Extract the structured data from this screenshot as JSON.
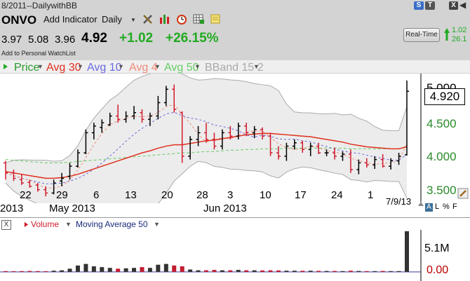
{
  "window": {
    "title": "8/2011--DailywithBB"
  },
  "toolbar": {
    "symbol": "ONVO",
    "add_indicator": "Add Indicator",
    "period": "Daily",
    "period_caret": "▼",
    "tools": [
      "wrench-icon",
      "bars-icon",
      "alarm-clock-icon",
      "grid-icon",
      "note-icon"
    ]
  },
  "top_right": {
    "s_badge": "S",
    "t_badge": "T",
    "close": "X",
    "arrow": "◀"
  },
  "quote": {
    "open": "3.97",
    "high": "5.08",
    "low": "3.96",
    "last": "4.92",
    "change": "+1.02",
    "change_pct": "+26.15%",
    "watchlist_link": "Add to Personal WatchList",
    "realtime_label": "Real-Time",
    "side_value_1": "1.02",
    "side_value_2": "26.1"
  },
  "colors": {
    "price": "#000000",
    "avg30": "#e0301e",
    "avg10": "#6a6ae0",
    "avg4": "#f08a7a",
    "avg50": "#66cc66",
    "bband": "#aaaaaa",
    "up_bar": "#000000",
    "down_bar": "#d01c2c",
    "positive": "#22aa22"
  },
  "legend": {
    "price": "Price",
    "avg30": "Avg 30",
    "avg10": "Avg 10",
    "avg4": "Avg 4",
    "avg50": "Avg 50",
    "bband": "BBand 15 2"
  },
  "x_axis": {
    "day_ticks": [
      "22",
      "29",
      "6",
      "13",
      "20",
      "28",
      "3",
      "10",
      "17",
      "24",
      "1"
    ],
    "month_labels": [
      "2013",
      "May 2013",
      "Jun 2013"
    ],
    "date_readout": "7/9/13"
  },
  "y_axis": {
    "ticks": [
      "5.000",
      "4.500",
      "4.000",
      "3.500"
    ],
    "current_price": "4.920"
  },
  "scale_controls": {
    "a": "A",
    "l": "L",
    "pct": "%",
    "f": "F"
  },
  "volume": {
    "close_x": "X",
    "label": "Volume",
    "ma_label": "Moving Average 50",
    "current": "5.1M",
    "zero": "0.00"
  },
  "chart_data": {
    "type": "ohlc",
    "title": "ONVO",
    "ylim": [
      3.3,
      5.1
    ],
    "series_names": [
      "Price",
      "Avg 30",
      "Avg 10",
      "Avg 4",
      "Avg 50",
      "BBand 15 2"
    ],
    "ohlc": [
      [
        3.85,
        3.88,
        3.6,
        3.7
      ],
      [
        3.7,
        3.75,
        3.58,
        3.62
      ],
      [
        3.6,
        3.68,
        3.52,
        3.55
      ],
      [
        3.56,
        3.6,
        3.48,
        3.5
      ],
      [
        3.52,
        3.55,
        3.42,
        3.45
      ],
      [
        3.45,
        3.5,
        3.35,
        3.4
      ],
      [
        3.4,
        3.6,
        3.38,
        3.55
      ],
      [
        3.58,
        3.7,
        3.5,
        3.62
      ],
      [
        3.65,
        3.85,
        3.6,
        3.8
      ],
      [
        3.8,
        4.05,
        3.78,
        4.0
      ],
      [
        4.0,
        4.35,
        3.98,
        4.3
      ],
      [
        4.3,
        4.45,
        4.2,
        4.4
      ],
      [
        4.38,
        4.5,
        4.3,
        4.45
      ],
      [
        4.42,
        4.6,
        4.4,
        4.55
      ],
      [
        4.55,
        4.72,
        4.45,
        4.5
      ],
      [
        4.5,
        4.62,
        4.45,
        4.55
      ],
      [
        4.55,
        4.7,
        4.5,
        4.6
      ],
      [
        4.6,
        4.65,
        4.45,
        4.5
      ],
      [
        4.5,
        4.6,
        4.4,
        4.55
      ],
      [
        4.55,
        4.85,
        4.5,
        4.75
      ],
      [
        4.75,
        5.0,
        4.7,
        4.95
      ],
      [
        4.95,
        5.02,
        4.6,
        4.65
      ],
      [
        4.6,
        4.62,
        3.85,
        3.95
      ],
      [
        3.95,
        4.25,
        3.9,
        4.2
      ],
      [
        4.2,
        4.4,
        4.1,
        4.3
      ],
      [
        4.3,
        4.45,
        4.15,
        4.2
      ],
      [
        4.2,
        4.3,
        4.05,
        4.1
      ],
      [
        4.1,
        4.35,
        4.05,
        4.3
      ],
      [
        4.3,
        4.4,
        4.2,
        4.25
      ],
      [
        4.25,
        4.45,
        4.2,
        4.4
      ],
      [
        4.4,
        4.45,
        4.25,
        4.3
      ],
      [
        4.3,
        4.4,
        4.22,
        4.35
      ],
      [
        4.35,
        4.38,
        4.2,
        4.25
      ],
      [
        4.25,
        4.3,
        3.95,
        4.0
      ],
      [
        4.0,
        4.1,
        3.9,
        3.95
      ],
      [
        3.95,
        4.15,
        3.88,
        4.1
      ],
      [
        4.1,
        4.2,
        4.05,
        4.15
      ],
      [
        4.15,
        4.18,
        4.0,
        4.05
      ],
      [
        4.05,
        4.15,
        3.95,
        4.1
      ],
      [
        4.1,
        4.15,
        3.98,
        4.0
      ],
      [
        4.0,
        4.05,
        3.95,
        4.0
      ],
      [
        4.0,
        4.08,
        3.9,
        3.95
      ],
      [
        3.95,
        4.02,
        3.88,
        3.98
      ],
      [
        3.98,
        4.05,
        3.7,
        3.75
      ],
      [
        3.75,
        3.9,
        3.68,
        3.85
      ],
      [
        3.85,
        3.92,
        3.78,
        3.82
      ],
      [
        3.82,
        3.95,
        3.76,
        3.9
      ],
      [
        3.9,
        3.98,
        3.78,
        3.8
      ],
      [
        3.8,
        3.92,
        3.75,
        3.88
      ],
      [
        3.88,
        4.0,
        3.82,
        3.95
      ],
      [
        3.97,
        5.08,
        3.96,
        4.92
      ]
    ],
    "avg30": [
      3.72,
      3.7,
      3.68,
      3.66,
      3.64,
      3.62,
      3.62,
      3.63,
      3.65,
      3.68,
      3.72,
      3.76,
      3.8,
      3.84,
      3.88,
      3.92,
      3.96,
      4.0,
      4.03,
      4.07,
      4.1,
      4.12,
      4.12,
      4.14,
      4.16,
      4.18,
      4.19,
      4.21,
      4.23,
      4.25,
      4.27,
      4.28,
      4.29,
      4.29,
      4.28,
      4.27,
      4.26,
      4.25,
      4.24,
      4.22,
      4.2,
      4.18,
      4.16,
      4.13,
      4.11,
      4.09,
      4.08,
      4.07,
      4.06,
      4.06,
      4.09
    ],
    "avg50": [
      3.9,
      3.89,
      3.88,
      3.87,
      3.86,
      3.85,
      3.85,
      3.85,
      3.86,
      3.87,
      3.88,
      3.89,
      3.9,
      3.91,
      3.92,
      3.93,
      3.94,
      3.95,
      3.96,
      3.97,
      3.98,
      3.99,
      4.0,
      4.0,
      4.01,
      4.02,
      4.02,
      4.03,
      4.04,
      4.04,
      4.05,
      4.05,
      4.06,
      4.06,
      4.06,
      4.07,
      4.07,
      4.07,
      4.07,
      4.07,
      4.07,
      4.07,
      4.07,
      4.06,
      4.06,
      4.06,
      4.06,
      4.06,
      4.06,
      4.06,
      4.1
    ],
    "volume": [
      0.1,
      0.08,
      0.1,
      0.12,
      0.1,
      0.08,
      0.15,
      0.2,
      0.4,
      0.8,
      1.0,
      0.7,
      0.6,
      0.5,
      0.4,
      0.45,
      0.5,
      0.6,
      0.5,
      0.9,
      1.0,
      0.8,
      0.7,
      0.3,
      0.2,
      0.2,
      0.25,
      0.2,
      0.2,
      0.25,
      0.2,
      0.2,
      0.18,
      0.2,
      0.18,
      0.15,
      0.15,
      0.14,
      0.15,
      0.13,
      0.12,
      0.12,
      0.1,
      0.15,
      0.12,
      0.1,
      0.1,
      0.12,
      0.1,
      0.1,
      5.1
    ]
  }
}
